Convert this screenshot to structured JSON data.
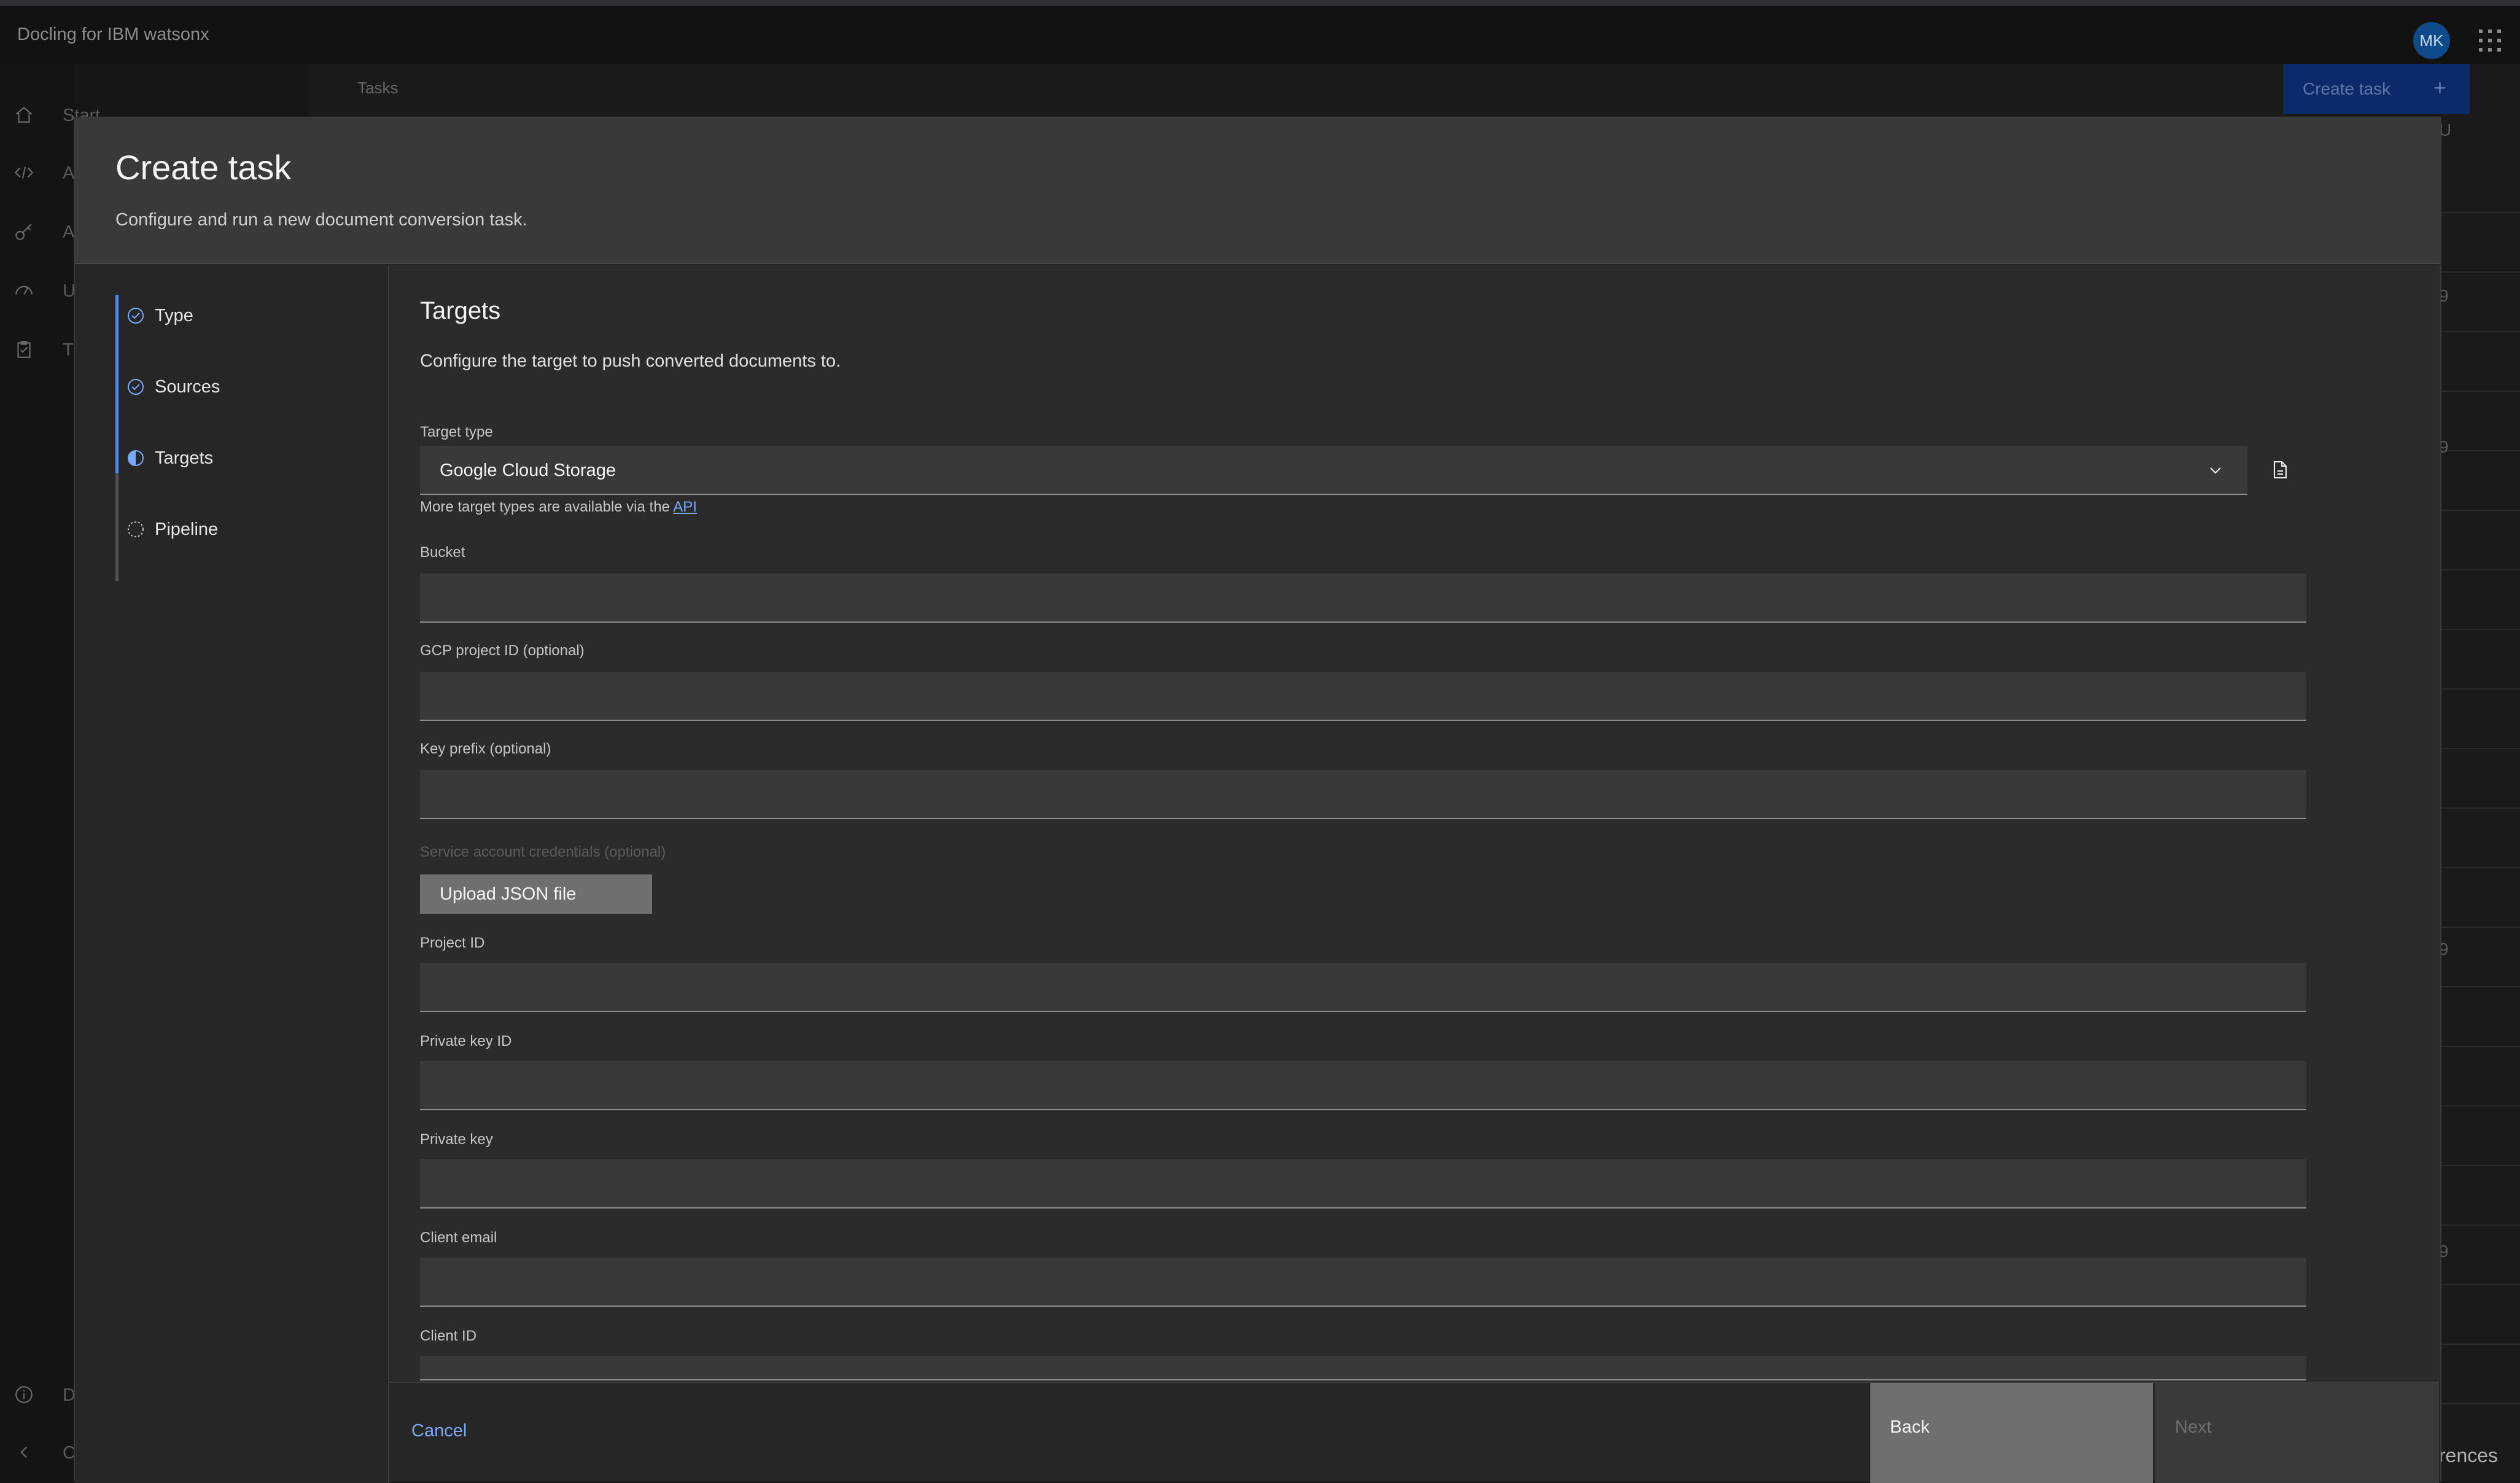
{
  "app": {
    "title": "Docling for IBM watsonx",
    "avatar_initials": "MK"
  },
  "leftnav": {
    "items": [
      {
        "label": "Start",
        "icon": "home-icon"
      },
      {
        "label": "A",
        "icon": "code-icon"
      },
      {
        "label": "A",
        "icon": "key-icon"
      },
      {
        "label": "U",
        "icon": "gauge-icon"
      },
      {
        "label": "T",
        "icon": "clipboard-icon"
      }
    ],
    "bottom_items": [
      {
        "label": "D",
        "icon": "info-icon"
      },
      {
        "label": "C",
        "icon": "chevron-left-icon"
      }
    ]
  },
  "background": {
    "breadcrumb": "Tasks",
    "create_task_label": "Create task",
    "right_column_fragments": [
      "U",
      "9",
      "9",
      "9",
      "9"
    ],
    "preferences_fragment": "rences"
  },
  "modal": {
    "title": "Create task",
    "subtitle": "Configure and run a new document conversion task.",
    "steps": [
      {
        "label": "Type",
        "state": "complete"
      },
      {
        "label": "Sources",
        "state": "complete"
      },
      {
        "label": "Targets",
        "state": "current"
      },
      {
        "label": "Pipeline",
        "state": "incomplete"
      }
    ],
    "section": {
      "title": "Targets",
      "description": "Configure the target to push converted documents to."
    },
    "target_type": {
      "label": "Target type",
      "value": "Google Cloud Storage",
      "helper_prefix": "More target types are available via the",
      "helper_link": "API"
    },
    "fields": {
      "bucket": {
        "label": "Bucket",
        "value": ""
      },
      "gcp_project_id": {
        "label": "GCP project ID (optional)",
        "value": ""
      },
      "key_prefix": {
        "label": "Key prefix (optional)",
        "value": ""
      },
      "service_account": {
        "label": "Service account credentials (optional)",
        "button": "Upload JSON file"
      },
      "project_id": {
        "label": "Project ID",
        "value": ""
      },
      "private_key_id": {
        "label": "Private key ID",
        "value": ""
      },
      "private_key": {
        "label": "Private key",
        "value": ""
      },
      "client_email": {
        "label": "Client email",
        "value": ""
      },
      "client_id": {
        "label": "Client ID",
        "value": ""
      }
    },
    "footer": {
      "cancel": "Cancel",
      "back": "Back",
      "next": "Next"
    }
  },
  "colors": {
    "accent": "#4589ff",
    "link": "#78a9ff",
    "modal_bg": "#262626"
  }
}
